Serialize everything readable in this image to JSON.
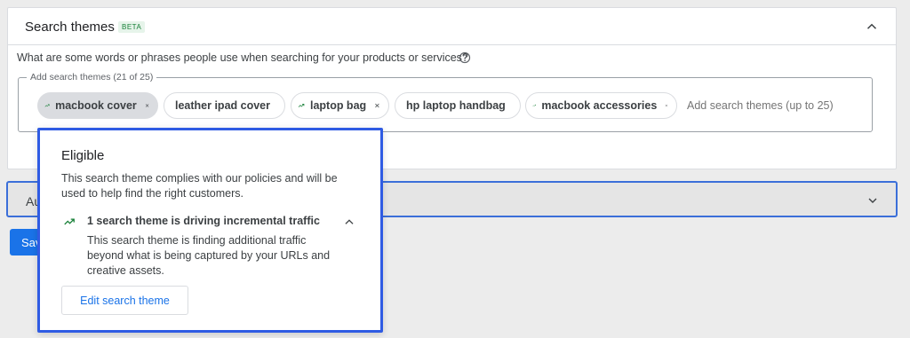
{
  "header": {
    "title": "Search themes",
    "badge": "BETA"
  },
  "question": "What are some words or phrases people use when searching for your products or services?",
  "field": {
    "label": "Add search themes (21 of 25)",
    "placeholder": "Add search themes (up to 25)",
    "chips": [
      {
        "label": "macbook cover"
      },
      {
        "label": "leather ipad cover"
      },
      {
        "label": "laptop bag"
      },
      {
        "label": "hp laptop handbag"
      },
      {
        "label": "macbook accessories"
      }
    ]
  },
  "collapsed_section": {
    "label": "Au"
  },
  "save_button": {
    "label": "Sav"
  },
  "popup": {
    "title": "Eligible",
    "description": "This search theme complies with our policies and will be used to help find the right customers.",
    "traffic_title": "1 search theme is driving incremental traffic",
    "traffic_description": "This search theme is finding additional traffic beyond what is being captured by your URLs and creative assets.",
    "edit_button": "Edit search theme"
  },
  "colors": {
    "accent": "#1a73e8",
    "positive": "#188038",
    "highlight_border": "#2f5be3"
  }
}
